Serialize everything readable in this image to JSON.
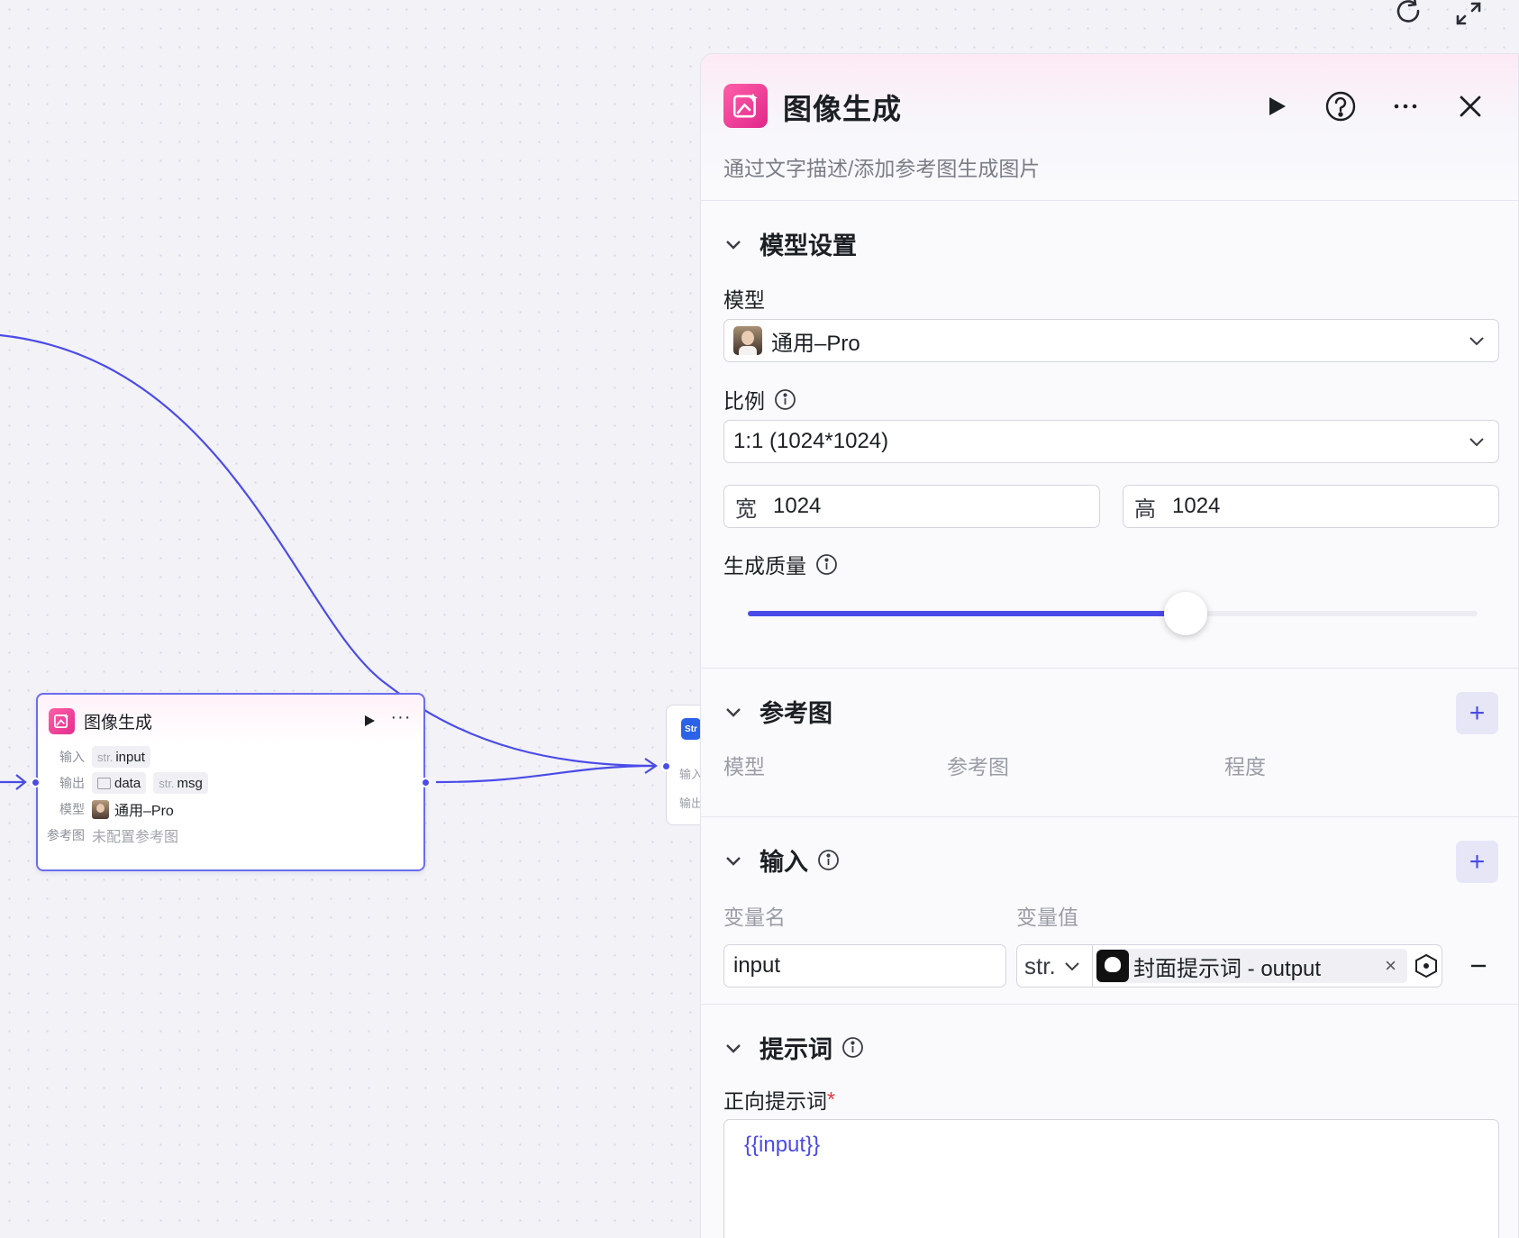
{
  "canvas": {
    "tools": [
      "refresh-icon",
      "expand-icon"
    ],
    "edge_color": "#4b4be8"
  },
  "node": {
    "title": "图像生成",
    "input_label": "输入",
    "input_var": {
      "type": "str.",
      "name": "input"
    },
    "output_label": "输出",
    "outputs": [
      {
        "type": "image",
        "name": "data"
      },
      {
        "type": "str.",
        "name": "msg"
      }
    ],
    "model_label": "模型",
    "model_value": "通用–Pro",
    "ref_label": "参考图",
    "ref_value": "未配置参考图"
  },
  "next_node": {
    "logo": "Str",
    "input_label": "输入",
    "output_label": "输出"
  },
  "panel": {
    "title": "图像生成",
    "description": "通过文字描述/添加参考图生成图片",
    "header_buttons": [
      "run-icon",
      "help-icon",
      "more-icon",
      "close-icon"
    ],
    "model_settings": {
      "title": "模型设置",
      "model_label": "模型",
      "model_value": "通用–Pro",
      "ratio_label": "比例",
      "ratio_value": "1:1 (1024*1024)",
      "width_label": "宽",
      "width_value": "1024",
      "height_label": "高",
      "height_value": "1024",
      "quality_label": "生成质量",
      "quality_fraction": 0.6
    },
    "reference": {
      "title": "参考图",
      "columns": [
        "模型",
        "参考图",
        "程度"
      ]
    },
    "input": {
      "title": "输入",
      "col_name": "变量名",
      "col_value": "变量值",
      "var_name": "input",
      "var_type": "str.",
      "ref_text": "封面提示词 - output",
      "ref_close": "×"
    },
    "prompt": {
      "title": "提示词",
      "positive_label": "正向提示词",
      "required_mark": "*",
      "positive_value": "{{input}}"
    }
  }
}
